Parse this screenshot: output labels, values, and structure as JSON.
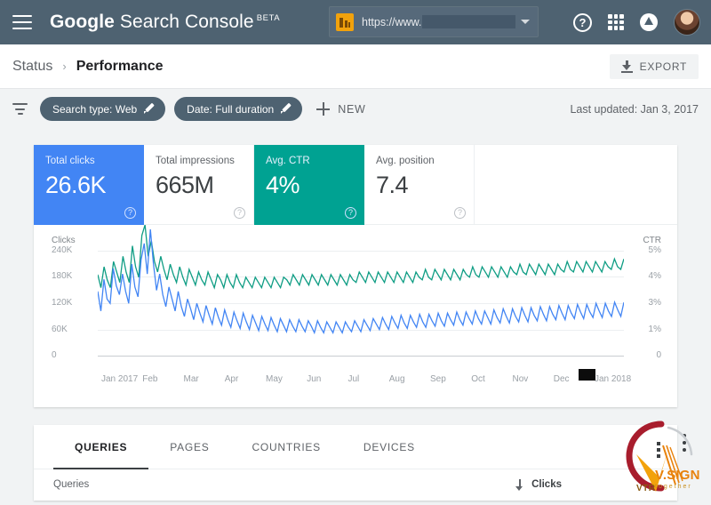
{
  "topbar": {
    "menu_icon": "hamburger-menu-icon",
    "brand_bold": "Google",
    "brand_light": " Search Console",
    "brand_beta": "BETA",
    "property": {
      "icon": "property-site-icon",
      "url": "https://www.",
      "caret_icon": "chevron-down-icon"
    },
    "help_icon": "help-icon",
    "help_glyph": "?",
    "apps_icon": "apps-grid-icon",
    "notifications_icon": "notification-bell-icon",
    "avatar": "user-avatar"
  },
  "breadcrumb": {
    "parent": "Status",
    "separator": "›",
    "current": "Performance",
    "export_label": "EXPORT",
    "export_icon": "download-icon"
  },
  "filterbar": {
    "filter_icon": "filter-icon",
    "chips": [
      {
        "label": "Search type: Web",
        "edit_icon": "pencil-icon"
      },
      {
        "label": "Date: Full duration",
        "edit_icon": "pencil-icon"
      }
    ],
    "new_label": "NEW",
    "new_icon": "plus-icon",
    "last_updated": "Last updated: Jan 3, 2017"
  },
  "metrics": [
    {
      "label": "Total clicks",
      "value": "26.6K",
      "state": "selected",
      "color": "#4285f4",
      "help_glyph": "?"
    },
    {
      "label": "Total impressions",
      "value": "665M",
      "state": "unselected",
      "color": "#ffffff",
      "help_glyph": "?"
    },
    {
      "label": "Avg. CTR",
      "value": "4%",
      "state": "selected",
      "color": "#00a292",
      "help_glyph": "?"
    },
    {
      "label": "Avg. position",
      "value": "7.4",
      "state": "unselected",
      "color": "#ffffff",
      "help_glyph": "?"
    }
  ],
  "chart_data": {
    "type": "line",
    "title": "",
    "xlabel": "",
    "ylabel": "Clicks",
    "y2label": "CTR",
    "grid": true,
    "legend": "none",
    "left_axis_title": "Clicks",
    "right_axis_title": "CTR",
    "yticks_left": [
      "240K",
      "180K",
      "120K",
      "60K",
      "0"
    ],
    "yticks_right": [
      "5%",
      "4%",
      "3%",
      "1%",
      "0"
    ],
    "ylim_left": [
      0,
      240000
    ],
    "ylim_right": [
      0,
      5
    ],
    "categories": [
      "Jan 2017",
      "Feb",
      "Mar",
      "Apr",
      "May",
      "Jun",
      "Jul",
      "Aug",
      "Sep",
      "Oct",
      "Nov",
      "Dec",
      "Jan 2018"
    ],
    "series": [
      {
        "name": "Clicks",
        "color": "#4285f4",
        "axis": "left",
        "values": [
          118,
          82,
          140,
          104,
          96,
          160,
          128,
          112,
          150,
          118,
          96,
          168,
          126,
          108,
          176,
          206,
          150,
          232,
          168,
          120,
          150,
          112,
          90,
          126,
          104,
          82,
          118,
          90,
          72,
          104,
          86,
          66,
          96,
          78,
          62,
          92,
          74,
          58,
          88,
          70,
          56,
          84,
          66,
          52,
          80,
          64,
          50,
          78,
          62,
          48,
          74,
          60,
          46,
          72,
          58,
          46,
          70,
          56,
          44,
          68,
          56,
          44,
          66,
          54,
          44,
          66,
          54,
          44,
          64,
          54,
          42,
          64,
          52,
          42,
          62,
          52,
          42,
          62,
          52,
          42,
          62,
          52,
          44,
          64,
          54,
          44,
          66,
          56,
          46,
          68,
          58,
          48,
          70,
          58,
          48,
          72,
          60,
          50,
          74,
          60,
          50,
          74,
          62,
          52,
          76,
          62,
          52,
          76,
          64,
          54,
          78,
          64,
          54,
          78,
          66,
          56,
          80,
          66,
          56,
          80,
          68,
          58,
          82,
          68,
          58,
          82,
          70,
          58,
          84,
          70,
          60,
          86,
          72,
          60,
          86,
          72,
          62,
          88,
          74,
          62,
          88,
          74,
          64,
          90,
          76,
          64,
          90,
          76,
          66,
          92,
          78,
          66,
          92,
          78,
          68,
          94,
          80,
          68,
          94,
          80,
          70,
          96,
          82,
          70,
          96,
          82,
          72,
          98,
          84,
          72,
          98
        ]
      },
      {
        "name": "CTR",
        "color": "#0f9d84",
        "axis": "right",
        "values": [
          3.1,
          2.6,
          3.4,
          2.9,
          2.6,
          3.6,
          3.2,
          2.8,
          3.8,
          3.2,
          2.8,
          4.2,
          3.4,
          3.0,
          4.6,
          5.0,
          3.8,
          4.4,
          3.6,
          3.2,
          3.8,
          3.3,
          2.9,
          3.5,
          3.1,
          2.8,
          3.4,
          3.0,
          2.7,
          3.3,
          3.0,
          2.7,
          3.2,
          2.9,
          2.7,
          3.2,
          2.9,
          2.6,
          3.1,
          2.9,
          2.6,
          3.1,
          2.8,
          2.6,
          3.1,
          2.8,
          2.6,
          3.0,
          2.8,
          2.6,
          3.0,
          2.8,
          2.6,
          3.0,
          2.8,
          2.6,
          3.0,
          2.8,
          2.6,
          3.0,
          2.9,
          2.7,
          3.1,
          2.9,
          2.7,
          3.1,
          2.9,
          2.7,
          3.1,
          2.9,
          2.7,
          3.1,
          2.9,
          2.7,
          3.1,
          2.9,
          2.7,
          3.1,
          2.9,
          2.7,
          3.1,
          2.9,
          2.8,
          3.2,
          3.0,
          2.8,
          3.2,
          3.0,
          2.8,
          3.2,
          3.0,
          2.8,
          3.2,
          3.0,
          2.8,
          3.2,
          3.0,
          2.8,
          3.2,
          3.0,
          2.8,
          3.2,
          3.0,
          2.9,
          3.3,
          3.0,
          2.9,
          3.3,
          3.1,
          2.9,
          3.3,
          3.1,
          2.9,
          3.3,
          3.1,
          2.9,
          3.3,
          3.1,
          3.0,
          3.4,
          3.1,
          3.0,
          3.4,
          3.2,
          3.0,
          3.4,
          3.2,
          3.0,
          3.4,
          3.2,
          3.0,
          3.4,
          3.2,
          3.1,
          3.5,
          3.2,
          3.1,
          3.5,
          3.3,
          3.1,
          3.5,
          3.3,
          3.1,
          3.5,
          3.3,
          3.1,
          3.5,
          3.3,
          3.2,
          3.6,
          3.3,
          3.2,
          3.6,
          3.4,
          3.2,
          3.6,
          3.4,
          3.2,
          3.6,
          3.4,
          3.2,
          3.6,
          3.4,
          3.3,
          3.7,
          3.4,
          3.3,
          3.7
        ]
      }
    ]
  },
  "tabs": [
    {
      "label": "QUERIES",
      "active": true
    },
    {
      "label": "PAGES",
      "active": false
    },
    {
      "label": "COUNTRIES",
      "active": false
    },
    {
      "label": "DEVICES",
      "active": false
    }
  ],
  "table": {
    "col_left": "Queries",
    "col_right": "Clicks",
    "sort_icon": "sort-descending-arrow-icon",
    "kebab_icon": "more-options-icon"
  },
  "watermark": {
    "mark": "VTR",
    "name": "V.SIGN",
    "tagline": "together"
  }
}
